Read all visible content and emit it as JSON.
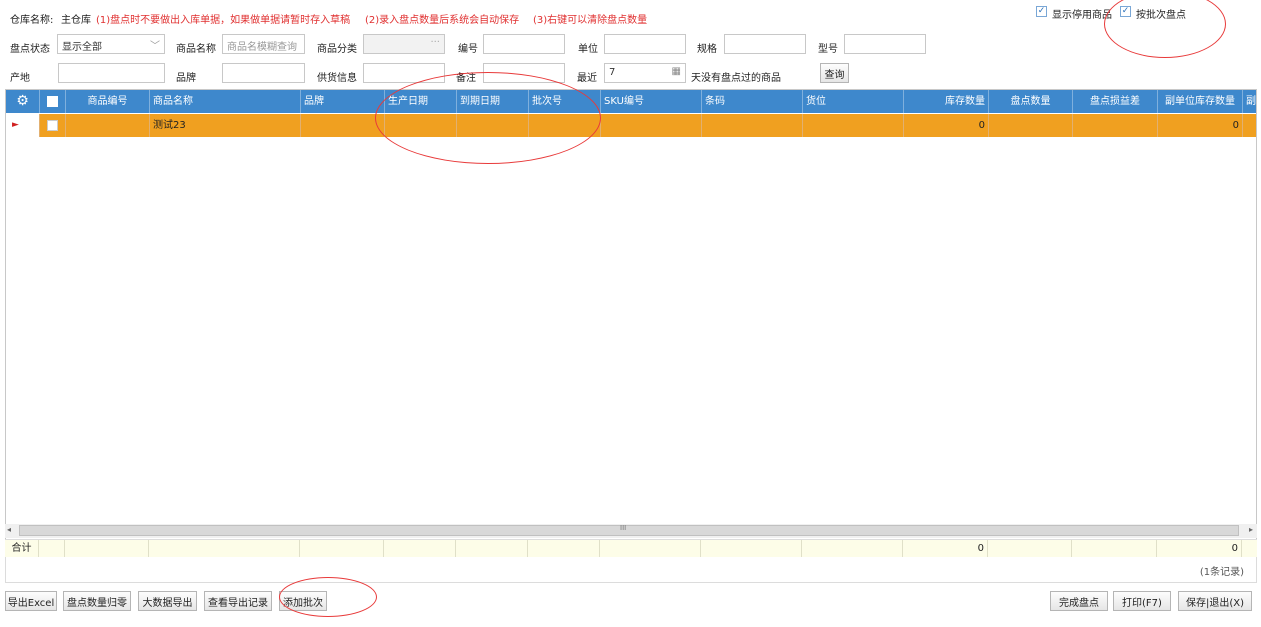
{
  "header": {
    "warehouse_label": "仓库名称:",
    "warehouse_value": "主仓库",
    "tip1": "(1)盘点时不要做出入库单据，如果做单据请暂时存入草稿",
    "tip2": "(2)录入盘点数量后系统会自动保存",
    "tip3": "(3)右键可以清除盘点数量",
    "show_disabled": "显示停用商品",
    "by_batch": "按批次盘点"
  },
  "filters": {
    "status_label": "盘点状态",
    "status_value": "显示全部",
    "name_label": "商品名称",
    "name_placeholder": "商品名模糊查询",
    "category_label": "商品分类",
    "code_label": "编号",
    "unit_label": "单位",
    "spec_label": "规格",
    "model_label": "型号",
    "origin_label": "产地",
    "brand_label": "品牌",
    "supplier_label": "供货信息",
    "remark_label": "备注",
    "recent_label": "最近",
    "recent_value": "7",
    "recent_suffix": "天没有盘点过的商品",
    "query_button": "查询"
  },
  "grid": {
    "columns": [
      "商品编号",
      "商品名称",
      "品牌",
      "生产日期",
      "到期日期",
      "批次号",
      "SKU编号",
      "条码",
      "货位",
      "库存数量",
      "盘点数量",
      "盘点损益差",
      "副单位库存数量",
      "副"
    ],
    "rows": [
      {
        "name": "测试23",
        "stock": "0",
        "sub_stock": "0"
      }
    ],
    "footer_label": "合计",
    "footer_stock": "0",
    "footer_sub": "0",
    "scroll_grip": "III"
  },
  "record_count": "(1条记录)",
  "buttons": {
    "export_excel": "导出Excel",
    "reset_count": "盘点数量归零",
    "big_export": "大数据导出",
    "view_export": "查看导出记录",
    "add_batch": "添加批次",
    "finish": "完成盘点",
    "print": "打印(F7)",
    "save_exit": "保存|退出(X)"
  }
}
